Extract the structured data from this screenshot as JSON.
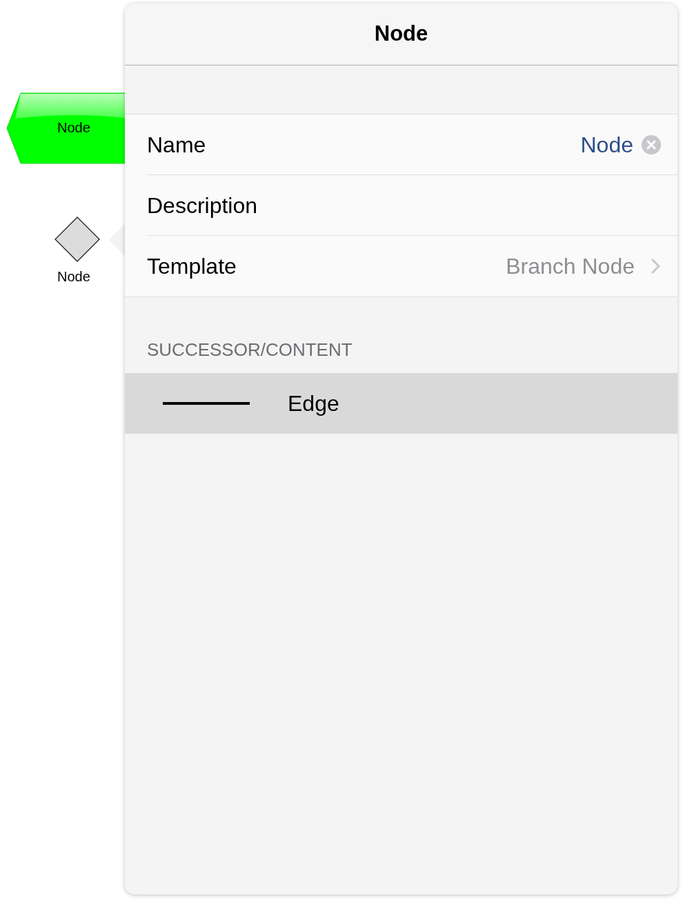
{
  "canvas": {
    "nodes": [
      {
        "kind": "chevron",
        "label": "Node"
      },
      {
        "kind": "diamond",
        "label": "Node"
      }
    ]
  },
  "popover": {
    "title": "Node",
    "fields": [
      {
        "kind": "text",
        "label": "Name",
        "value": "Node",
        "clearable": true
      },
      {
        "kind": "text",
        "label": "Description"
      },
      {
        "kind": "link",
        "label": "Template",
        "value": "Branch Node"
      }
    ],
    "section": {
      "header": "SUCCESSOR/CONTENT",
      "items": [
        {
          "label": "Edge",
          "selected": true
        }
      ]
    }
  }
}
